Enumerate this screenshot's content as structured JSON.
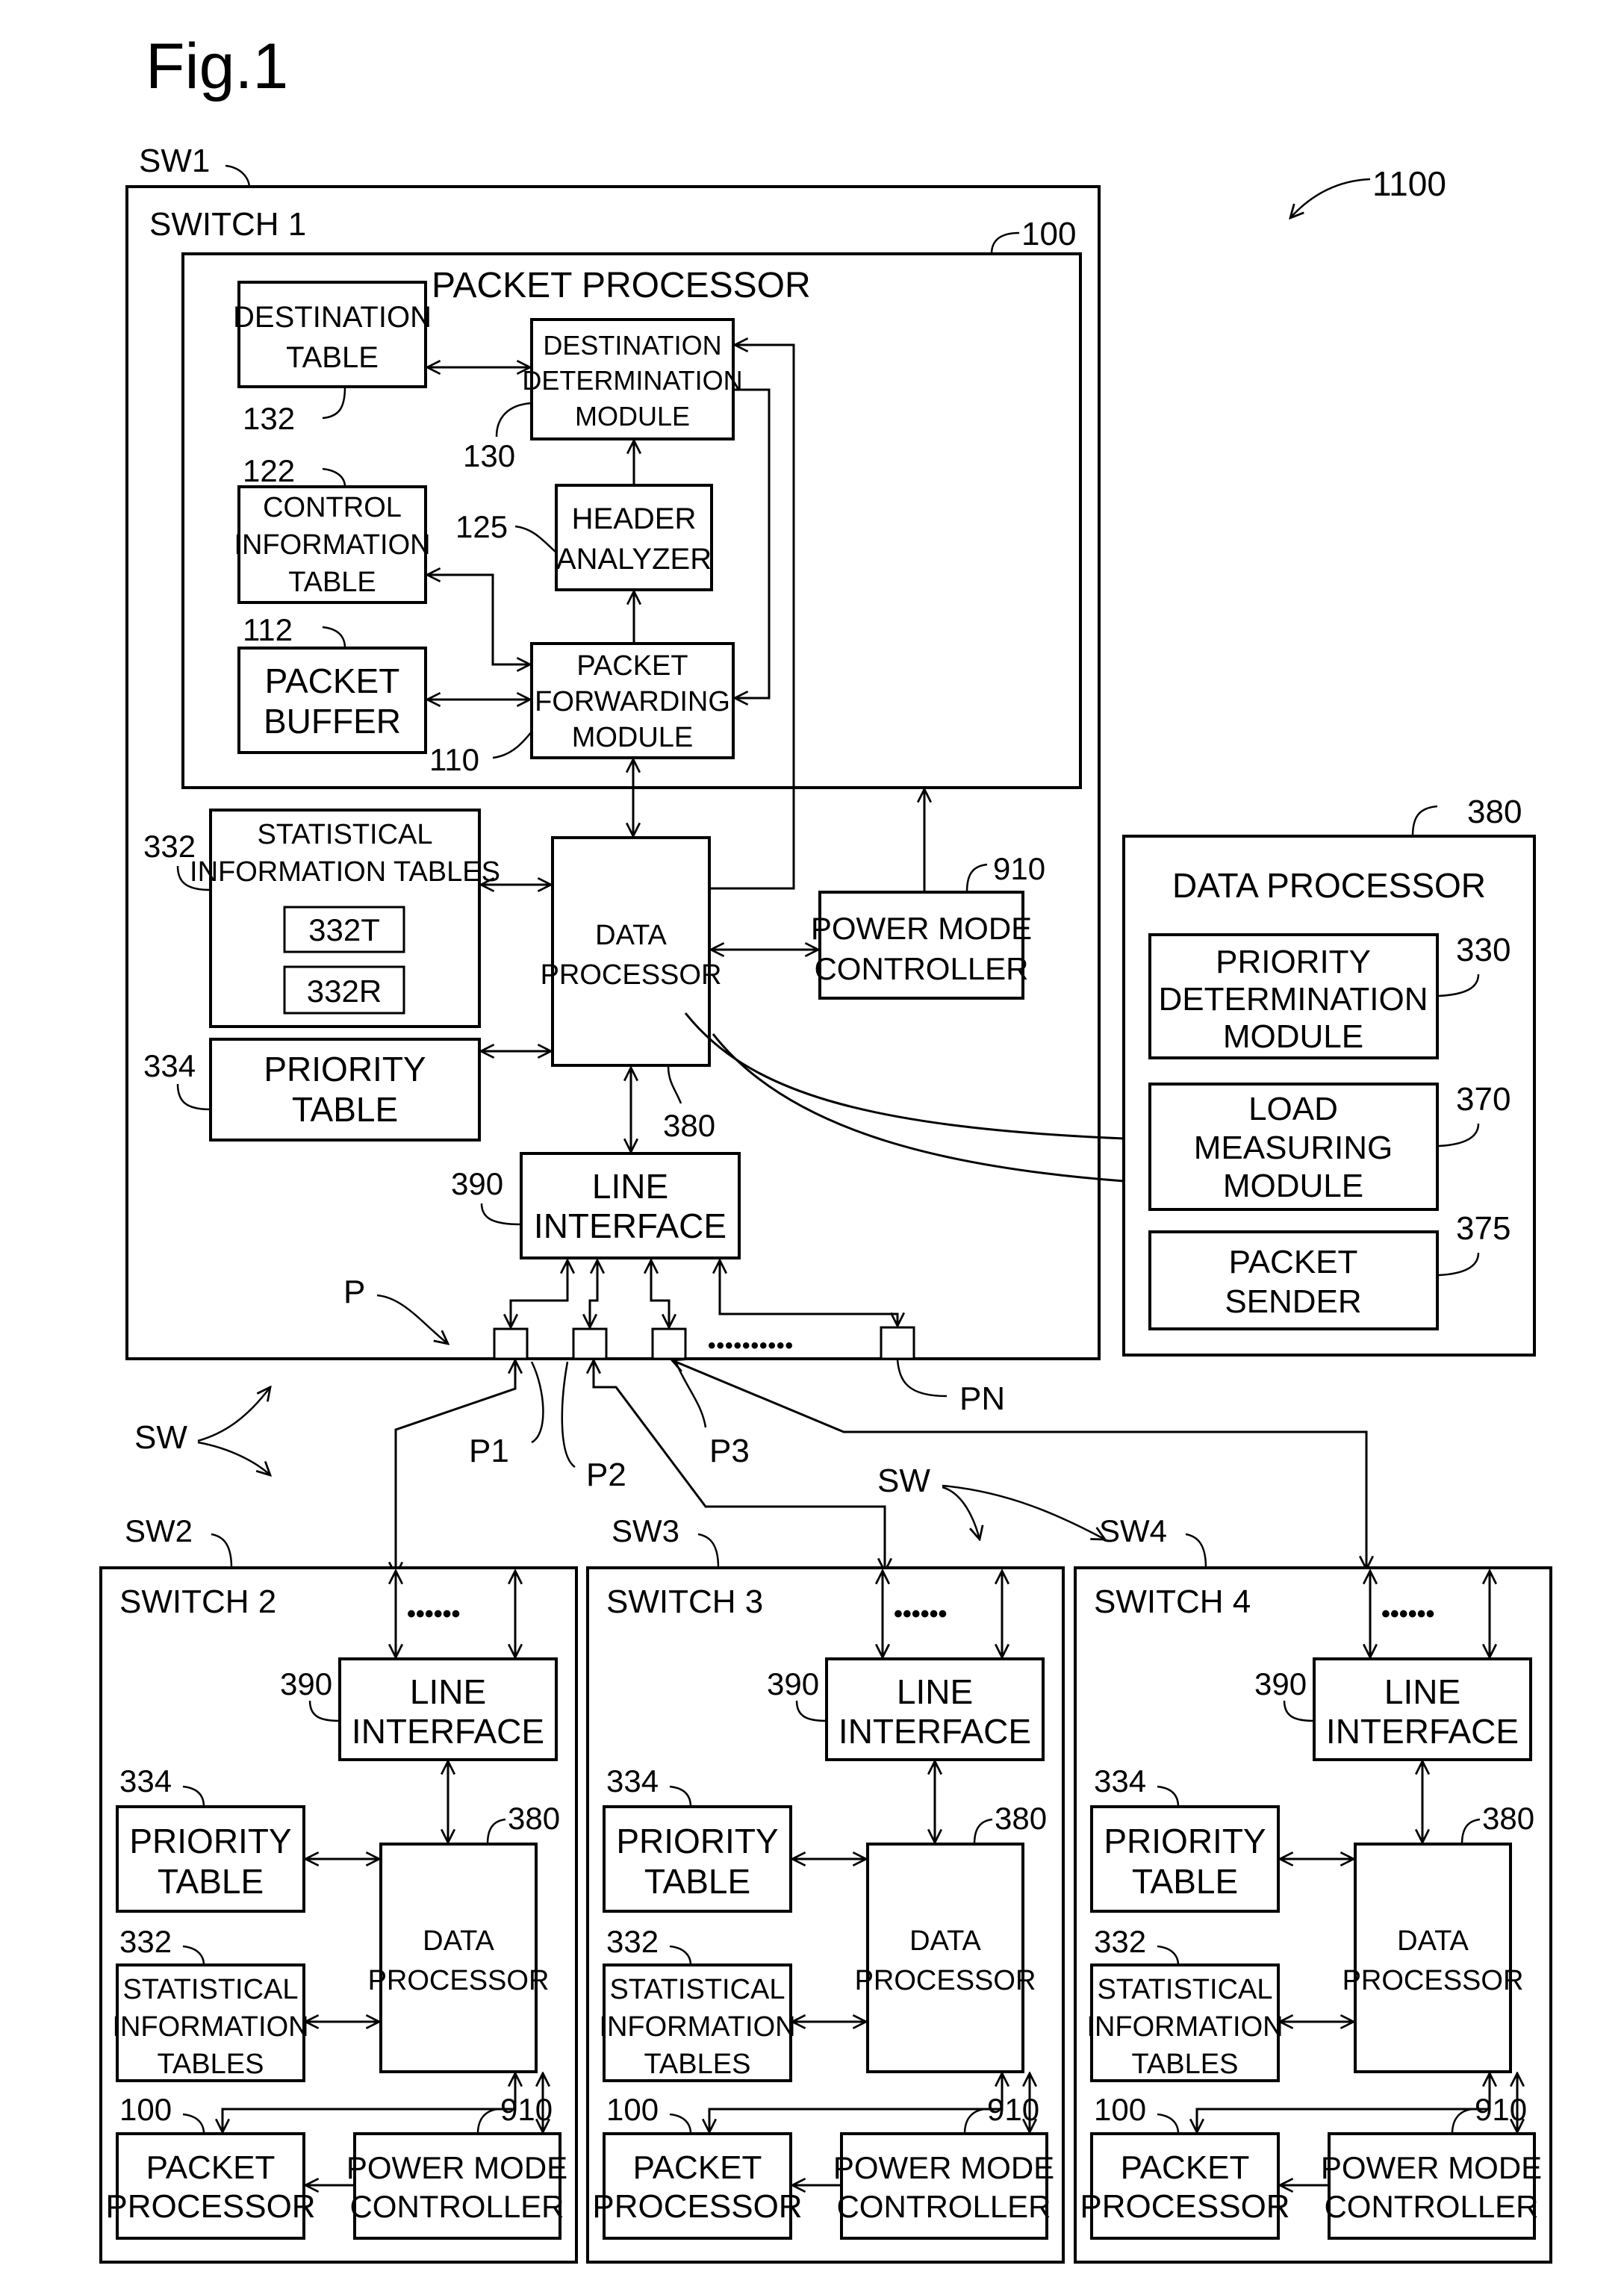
{
  "figure": {
    "title": "Fig.1",
    "system_ref": "1100"
  },
  "switch1": {
    "ref": "SW1",
    "title": "SWITCH 1",
    "packet_processor": {
      "ref": "100",
      "title": "PACKET PROCESSOR",
      "destination_table": {
        "lines": [
          "DESTINATION",
          "TABLE"
        ],
        "ref": "132"
      },
      "destination_determination": {
        "lines": [
          "DESTINATION",
          "DETERMINATION",
          "MODULE"
        ],
        "ref": "130"
      },
      "control_info_table": {
        "lines": [
          "CONTROL",
          "INFORMATION",
          "TABLE"
        ],
        "ref": "122"
      },
      "header_analyzer": {
        "lines": [
          "HEADER",
          "ANALYZER"
        ],
        "ref": "125"
      },
      "packet_buffer": {
        "lines": [
          "PACKET",
          "BUFFER"
        ],
        "ref": "112"
      },
      "packet_forwarding": {
        "lines": [
          "PACKET",
          "FORWARDING",
          "MODULE"
        ],
        "ref": "110"
      }
    },
    "stat_tables": {
      "lines": [
        "STATISTICAL",
        "INFORMATION TABLES"
      ],
      "ref": "332",
      "sub": [
        "332T",
        "332R"
      ]
    },
    "priority_table": {
      "lines": [
        "PRIORITY",
        "TABLE"
      ],
      "ref": "334"
    },
    "data_processor": {
      "lines": [
        "DATA",
        "PROCESSOR"
      ],
      "ref": "380"
    },
    "power_mode": {
      "lines": [
        "POWER MODE",
        "CONTROLLER"
      ],
      "ref": "910"
    },
    "line_interface": {
      "lines": [
        "LINE",
        "INTERFACE"
      ],
      "ref": "390"
    },
    "ports": {
      "group_ref": "P",
      "p1": "P1",
      "p2": "P2",
      "p3": "P3",
      "pn": "PN",
      "ellipsis": "••••••••••"
    }
  },
  "data_processor_detail": {
    "ref": "380",
    "title": "DATA PROCESSOR",
    "modules": [
      {
        "lines": [
          "PRIORITY",
          "DETERMINATION",
          "MODULE"
        ],
        "ref": "330"
      },
      {
        "lines": [
          "LOAD",
          "MEASURING",
          "MODULE"
        ],
        "ref": "370"
      },
      {
        "lines": [
          "PACKET",
          "SENDER"
        ],
        "ref": "375"
      }
    ]
  },
  "sw_labels": [
    "SW",
    "SW"
  ],
  "switches": [
    {
      "ref": "SW2",
      "title": "SWITCH 2"
    },
    {
      "ref": "SW3",
      "title": "SWITCH 3"
    },
    {
      "ref": "SW4",
      "title": "SWITCH 4"
    }
  ],
  "sub_switch": {
    "ellipsis": "••••••",
    "line_interface": {
      "lines": [
        "LINE",
        "INTERFACE"
      ],
      "ref": "390"
    },
    "priority_table": {
      "lines": [
        "PRIORITY",
        "TABLE"
      ],
      "ref": "334"
    },
    "stat_tables": {
      "lines": [
        "STATISTICAL",
        "INFORMATION",
        "TABLES"
      ],
      "ref": "332"
    },
    "data_processor": {
      "lines": [
        "DATA",
        "PROCESSOR"
      ],
      "ref": "380"
    },
    "packet_processor": {
      "lines": [
        "PACKET",
        "PROCESSOR"
      ],
      "ref": "100"
    },
    "power_mode": {
      "lines": [
        "POWER MODE",
        "CONTROLLER"
      ],
      "ref": "910"
    }
  }
}
